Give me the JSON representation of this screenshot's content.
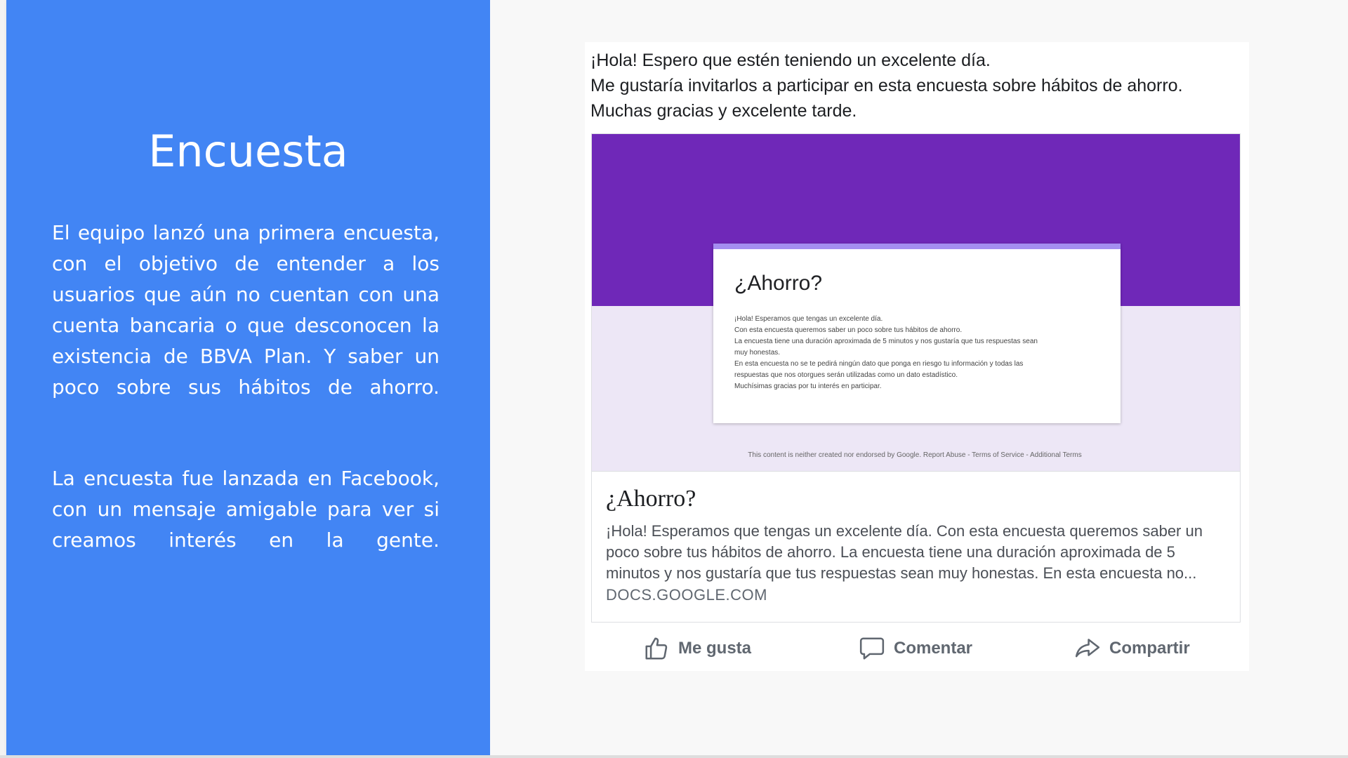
{
  "left": {
    "title": "Encuesta",
    "paragraph1": "El equipo lanzó una primera encuesta, con el objetivo de entender a los usuarios que aún no cuentan con una cuenta bancaria o que desconocen la existencia de BBVA Plan. Y saber un poco sobre sus hábitos de ahorro.",
    "paragraph2": "La encuesta fue lanzada en Facebook, con un mensaje amigable para ver si creamos interés en la gente."
  },
  "post": {
    "lines": [
      "¡Hola! Espero que estén teniendo un excelente día.",
      "Me gustaría invitarlos a participar en esta encuesta sobre hábitos de ahorro.",
      "Muchas gracias y excelente tarde."
    ],
    "preview": {
      "form_title": "¿Ahorro?",
      "form_lines": [
        "¡Hola! Esperamos que tengas un excelente día.",
        "Con esta encuesta queremos saber un poco sobre tus hábitos de ahorro.",
        "La encuesta tiene una duración aproximada de 5 minutos y nos gustaría que tus respuestas sean",
        "muy honestas.",
        "En esta encuesta no se te pedirá ningún dato que ponga en riesgo tu información y todas las",
        "respuestas que nos otorgues serán utilizadas como un dato estadístico.",
        "Muchísimas gracias por tu interés en participar."
      ],
      "footer": "This content is neither created nor endorsed by Google. Report Abuse - Terms of Service - Additional Terms"
    },
    "card": {
      "title": "¿Ahorro?",
      "description": "¡Hola! Esperamos que tengas un excelente día. Con esta encuesta queremos saber un poco sobre tus hábitos de ahorro. La encuesta tiene una duración aproximada de 5 minutos y nos gustaría que tus respuestas sean muy honestas. En esta encuesta no...",
      "domain": "DOCS.GOOGLE.COM"
    },
    "actions": {
      "like": "Me gusta",
      "comment": "Comentar",
      "share": "Compartir"
    }
  },
  "colors": {
    "panel": "#4285f4",
    "form_header": "#6f28b8",
    "form_background": "#ede7f6"
  },
  "icons": [
    "thumbs-up-icon",
    "comment-icon",
    "share-icon"
  ]
}
